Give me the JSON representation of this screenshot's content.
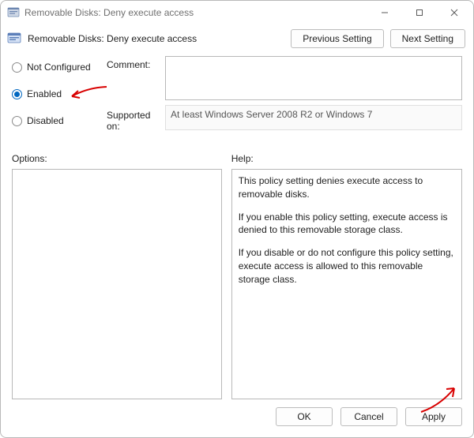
{
  "window": {
    "title": "Removable Disks: Deny execute access"
  },
  "header": {
    "policy_title": "Removable Disks: Deny execute access",
    "previous_btn": "Previous Setting",
    "next_btn": "Next Setting"
  },
  "state": {
    "not_configured_label": "Not Configured",
    "enabled_label": "Enabled",
    "disabled_label": "Disabled",
    "selected": "enabled"
  },
  "comment": {
    "label": "Comment:",
    "value": ""
  },
  "supported": {
    "label": "Supported on:",
    "value": "At least Windows Server 2008 R2 or Windows 7"
  },
  "panes": {
    "options_label": "Options:",
    "help_label": "Help:"
  },
  "help": {
    "p1": "This policy setting denies execute access to removable disks.",
    "p2": "If you enable this policy setting, execute access is denied to this removable storage class.",
    "p3": "If you disable or do not configure this policy setting, execute access is allowed to this removable storage class."
  },
  "footer": {
    "ok": "OK",
    "cancel": "Cancel",
    "apply": "Apply"
  }
}
